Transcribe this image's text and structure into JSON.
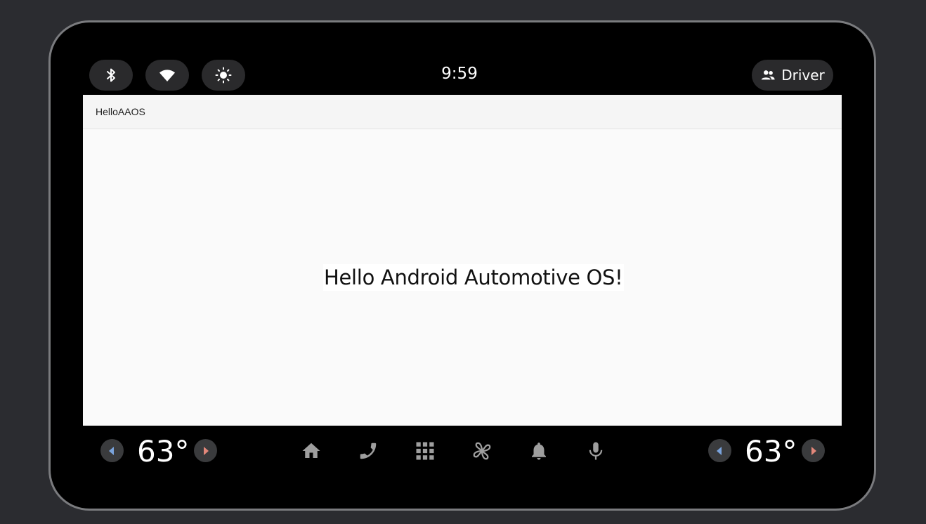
{
  "status_bar": {
    "clock": "9:59",
    "profile_label": "Driver",
    "quick_settings": [
      "bluetooth-icon",
      "wifi-icon",
      "brightness-icon"
    ]
  },
  "app": {
    "title": "HelloAAOS",
    "message": "Hello Android Automotive OS!"
  },
  "hvac": {
    "left_temp": "63°",
    "right_temp": "63°"
  },
  "nav_bar": {
    "icons": [
      "home-icon",
      "phone-icon",
      "apps-grid-icon",
      "fan-icon",
      "notifications-icon",
      "microphone-icon"
    ]
  },
  "colors": {
    "background": "#2b2c30",
    "bezel": "#000000",
    "app_background": "#fafafa",
    "cool_arrow": "#7aa3dc",
    "warm_arrow": "#e2877a"
  }
}
